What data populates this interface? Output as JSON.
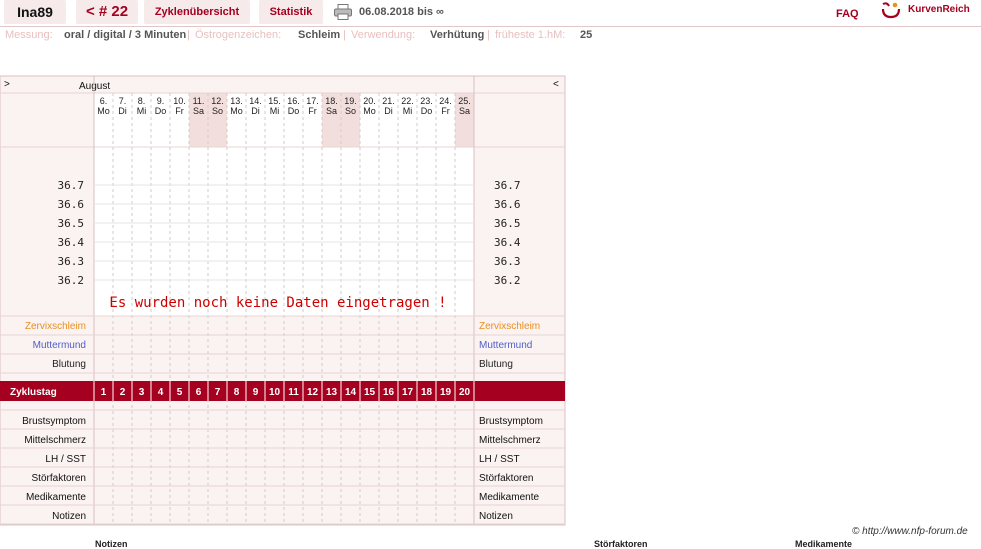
{
  "header": {
    "user": "Ina89",
    "cycle_nav": "< # 22",
    "tab_cycles": "Zyklenübersicht",
    "tab_stats": "Statistik",
    "date_range": "06.08.2018 bis ∞",
    "faq": "FAQ",
    "brand": "KurvenReich",
    "printer_icon": "printer-icon",
    "logo_icon": "kurvenreich-logo-icon",
    "accent_color": "#a5001f"
  },
  "info": {
    "measure_label": "Messung:",
    "measure_value": "oral / digital / 3 Minuten",
    "estrogen_label": "Östrogenzeichen:",
    "estrogen_value": "Schleim",
    "usage_label": "Verwendung:",
    "usage_value": "Verhütung",
    "earliest_label": "früheste 1.hM:",
    "earliest_value": "25"
  },
  "chart": {
    "nav_next": ">",
    "nav_prev": "<",
    "month": "August",
    "days": [
      {
        "d": "6.",
        "w": "Mo",
        "we": false
      },
      {
        "d": "7.",
        "w": "Di",
        "we": false
      },
      {
        "d": "8.",
        "w": "Mi",
        "we": false
      },
      {
        "d": "9.",
        "w": "Do",
        "we": false
      },
      {
        "d": "10.",
        "w": "Fr",
        "we": false
      },
      {
        "d": "11.",
        "w": "Sa",
        "we": true
      },
      {
        "d": "12.",
        "w": "So",
        "we": true
      },
      {
        "d": "13.",
        "w": "Mo",
        "we": false
      },
      {
        "d": "14.",
        "w": "Di",
        "we": false
      },
      {
        "d": "15.",
        "w": "Mi",
        "we": false
      },
      {
        "d": "16.",
        "w": "Do",
        "we": false
      },
      {
        "d": "17.",
        "w": "Fr",
        "we": false
      },
      {
        "d": "18.",
        "w": "Sa",
        "we": true
      },
      {
        "d": "19.",
        "w": "So",
        "we": true
      },
      {
        "d": "20.",
        "w": "Mo",
        "we": false
      },
      {
        "d": "21.",
        "w": "Di",
        "we": false
      },
      {
        "d": "22.",
        "w": "Mi",
        "we": false
      },
      {
        "d": "23.",
        "w": "Do",
        "we": false
      },
      {
        "d": "24.",
        "w": "Fr",
        "we": false
      },
      {
        "d": "25.",
        "w": "Sa",
        "we": true
      }
    ],
    "temps": [
      "36.7",
      "36.6",
      "36.5",
      "36.4",
      "36.3",
      "36.2"
    ],
    "no_data": "Es wurden noch keine Daten eingetragen !",
    "cycle_label": "Zyklustag",
    "cycle_days": [
      "1",
      "2",
      "3",
      "4",
      "5",
      "6",
      "7",
      "8",
      "9",
      "10",
      "11",
      "12",
      "13",
      "14",
      "15",
      "16",
      "17",
      "18",
      "19",
      "20"
    ],
    "rows_top": [
      {
        "label": "Zervixschleim",
        "color": "#e89020"
      },
      {
        "label": "Muttermund",
        "color": "#5060c8"
      },
      {
        "label": "Blutung",
        "color": "#222222"
      }
    ],
    "rows_bottom": [
      "Brustsymptom",
      "Mittelschmerz",
      "LH / SST",
      "Störfaktoren",
      "Medikamente",
      "Notizen"
    ]
  },
  "footer": {
    "copyright": "© http://www.nfp-forum.de",
    "cut_notizen": "Notizen",
    "cut_stoer": "Störfaktoren",
    "cut_medi": "Medikamente"
  }
}
